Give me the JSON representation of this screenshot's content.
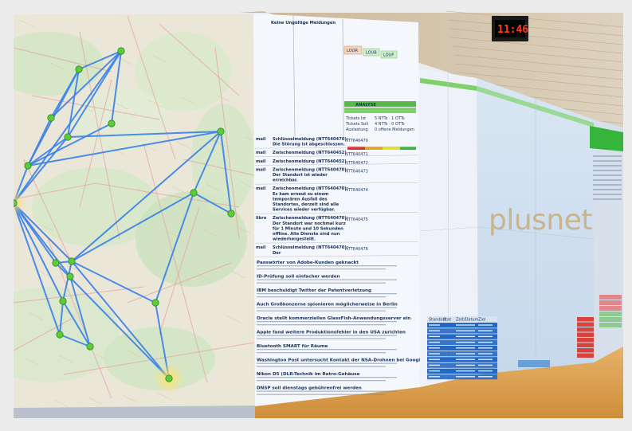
{
  "brand_logo": "plusnet",
  "wall_clock": "11:46",
  "panel_title": "Keine Ungültige Meldungen",
  "panel_badges": [
    "LOOR",
    "LOUB",
    "LOUP"
  ],
  "status_box_header": "ANALYSE",
  "status_box_lines": [
    "Tickets Ist",
    "Tickets Soll",
    "Auslastung"
  ],
  "incidents": [
    {
      "tag": "mail",
      "text": "Schlüsselmeldung (NTT640470): Die Störung ist abgeschlossen."
    },
    {
      "tag": "mail",
      "text": "Zwischenmeldung (NTT640452)"
    },
    {
      "tag": "mail",
      "text": "Zwischenmeldung (NTT640452)"
    },
    {
      "tag": "mail",
      "text": "Zwischenmeldung (NTT640470): Der Standort ist wieder erreichbar."
    },
    {
      "tag": "mail",
      "text": "Zwischenmeldung (NTT640470): Es kam erneut zu einem temporären Ausfall des Standortes, derzeit sind alle Services wieder verfügbar."
    },
    {
      "tag": "libre",
      "text": "Zwischenmeldung (NTT640470): Der Standort war nochmal kurz für 1 Minute und 10 Sekunden offline. Alle Dienste sind nun wiederhergestellt."
    },
    {
      "tag": "mail",
      "text": "Schlüsselmeldung (NTT640470): Der"
    }
  ],
  "news_items": [
    "Passwörter von Adobe-Kunden geknackt",
    "ID-Prüfung soll einfacher werden",
    "IBM beschuldigt Twitter der Patentverletzung",
    "Auch Großkonzerne spionieren möglicherweise in Berlin",
    "Oracle stellt kommerziellen GlassFish-Anwendungsserver ein",
    "Apple fand weitere Produktionsfehler in den USA zurichten",
    "Bluetooth SMART für Räume",
    "Washington Post untersucht Kontakt der NSA-Drohnen bei Google",
    "Nikon D5 (DLR-Technik im Retro-Gehäuse",
    "DNSP soll dienstags gebührenfrei werden"
  ],
  "ticket_table_headers": [
    "Standort",
    "Stat",
    "Zeit/Datum",
    "Ziel"
  ],
  "ticket_count": 10,
  "colors": {
    "map_route": "#3a82e8",
    "map_node": "#5ecb3a",
    "accent_green": "#29c232",
    "table_blue": "#2268c4",
    "alert_red": "#d8322a",
    "brand_text": "#c8b48f"
  }
}
